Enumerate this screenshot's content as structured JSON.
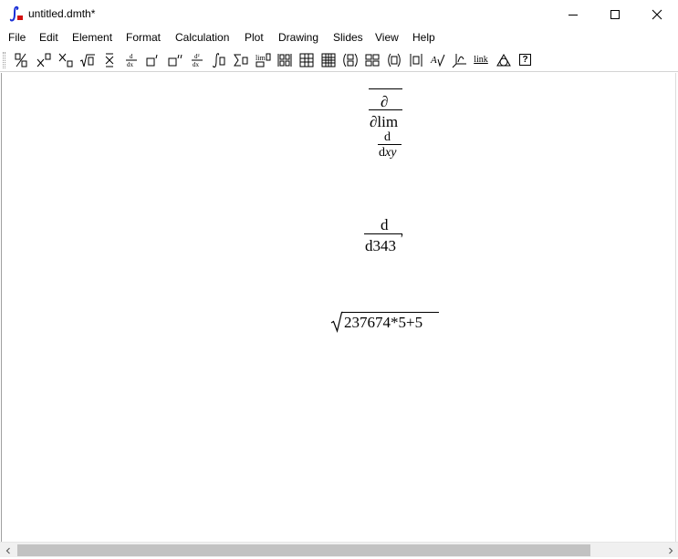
{
  "window": {
    "title": "untitled.dmth*",
    "app_icon": "integral-icon"
  },
  "menu": [
    "File",
    "Edit",
    "Element",
    "Format",
    "Calculation",
    "Plot",
    "Drawing",
    "Slides",
    "View",
    "Help"
  ],
  "toolbar": {
    "link_label": "link",
    "help_label": "?",
    "lim_label": "lim"
  },
  "expressions": {
    "expr1": {
      "numerator": "∂",
      "denominator": "∂lim",
      "sub_numerator": "d",
      "sub_denominator_prefix": "d",
      "sub_denominator_var": "xy"
    },
    "expr2": {
      "numerator": "d",
      "denominator": "d343",
      "prime": "′"
    },
    "expr3": {
      "radicand": "237674*5+5"
    }
  },
  "colors": {
    "accent_icon_blue": "#1a2fd6",
    "accent_icon_red": "#d41010",
    "scroll_thumb": "#c2c2c2"
  }
}
